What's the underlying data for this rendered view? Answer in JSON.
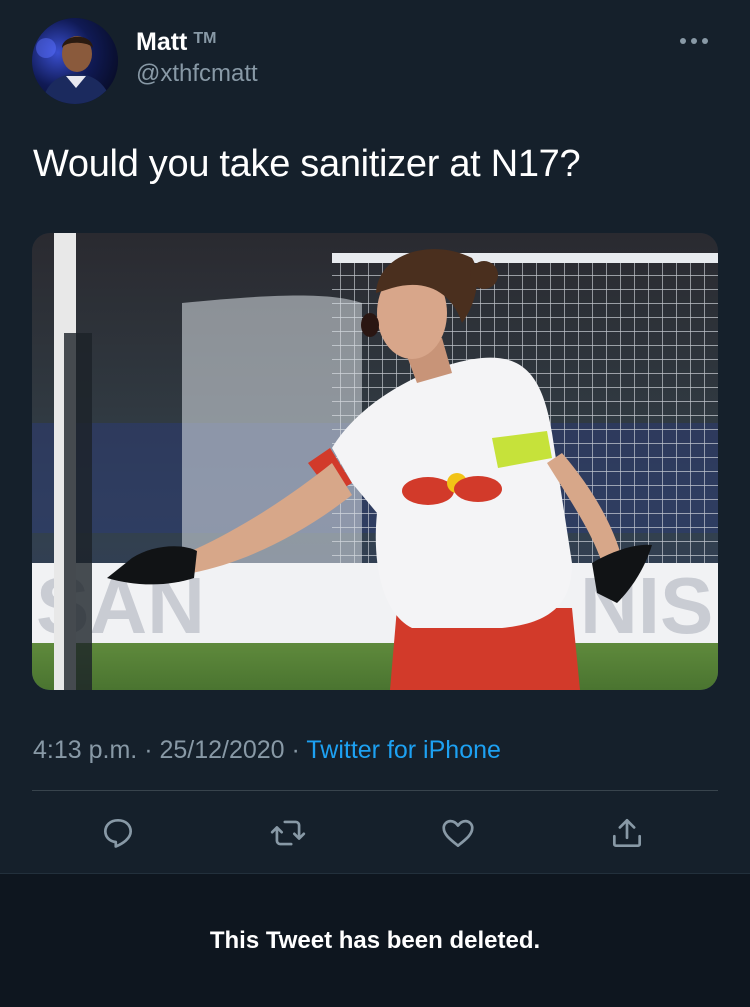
{
  "user": {
    "display_name": "Matt",
    "tm": "TM",
    "handle": "@xthfcmatt"
  },
  "tweet": {
    "text": "Would you take sanitizer at N17?",
    "time": "4:13 p.m.",
    "date": "25/12/2020",
    "separator": "·",
    "source": "Twitter for iPhone"
  },
  "media": {
    "board_text_left": "SAN",
    "board_text_right": "NIS"
  },
  "banner": {
    "text": "This Tweet has been deleted."
  },
  "colors": {
    "background": "#15202b",
    "secondary_text": "#8899a6",
    "link": "#1da1f2",
    "banner_bg": "#0e161f"
  },
  "icons": [
    "more-icon",
    "reply-icon",
    "retweet-icon",
    "like-icon",
    "share-icon"
  ]
}
